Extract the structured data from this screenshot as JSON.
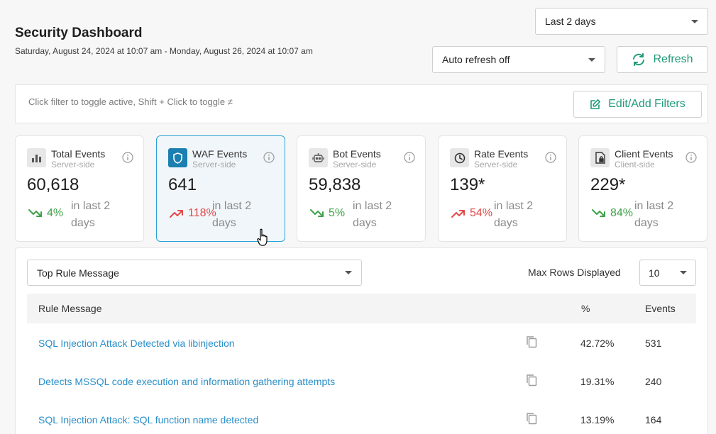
{
  "header": {
    "title": "Security Dashboard",
    "date_range": "Saturday, August 24, 2024 at 10:07 am - Monday, August 26, 2024 at 10:07 am"
  },
  "time_range": {
    "selected": "Last 2 days"
  },
  "auto_refresh": {
    "selected": "Auto refresh off"
  },
  "refresh_button": {
    "label": "Refresh",
    "icon": "refresh-icon"
  },
  "filter_bar": {
    "hint": "Click filter to toggle active, Shift + Click to toggle ≠",
    "edit_label": "Edit/Add Filters",
    "edit_icon": "edit-icon"
  },
  "cards": [
    {
      "title": "Total Events",
      "subtitle": "Server-side",
      "value": "60,618",
      "pct": "4%",
      "trend": "down",
      "period": "in last 2 days",
      "icon": "bar-chart-icon",
      "active": false
    },
    {
      "title": "WAF Events",
      "subtitle": "Server-side",
      "value": "641",
      "pct": "118%",
      "trend": "up",
      "period": "in last 2 days",
      "icon": "shield-icon",
      "active": true
    },
    {
      "title": "Bot Events",
      "subtitle": "Server-side",
      "value": "59,838",
      "pct": "5%",
      "trend": "down",
      "period": "in last 2 days",
      "icon": "robot-icon",
      "active": false
    },
    {
      "title": "Rate Events",
      "subtitle": "Server-side",
      "value": "139*",
      "pct": "54%",
      "trend": "up",
      "period": "in last 2 days",
      "icon": "clock-icon",
      "active": false
    },
    {
      "title": "Client Events",
      "subtitle": "Client-side",
      "value": "229*",
      "pct": "84%",
      "trend": "down",
      "period": "in last 2 days",
      "icon": "client-file-icon",
      "active": false
    }
  ],
  "table": {
    "group_by": "Top Rule Message",
    "max_rows_label": "Max Rows Displayed",
    "max_rows": "10",
    "columns": [
      "Rule Message",
      "%",
      "Events"
    ],
    "rows": [
      {
        "message": "SQL Injection Attack Detected via libinjection",
        "pct": "42.72%",
        "events": "531"
      },
      {
        "message": "Detects MSSQL code execution and information gathering attempts",
        "pct": "19.31%",
        "events": "240"
      },
      {
        "message": "SQL Injection Attack: SQL function name detected",
        "pct": "13.19%",
        "events": "164"
      }
    ]
  },
  "colors": {
    "accent_green": "#1f9a78",
    "link_blue": "#2a8fc9",
    "active_border": "#2aa3d6",
    "trend_up": "#e14a4a",
    "trend_down": "#3fa14a"
  }
}
